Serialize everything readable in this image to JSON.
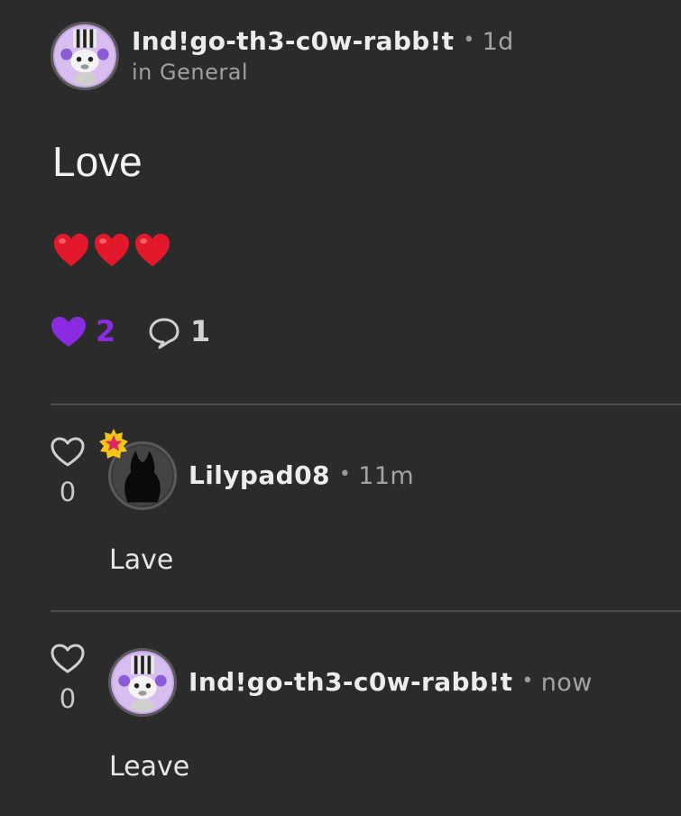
{
  "post": {
    "author": "Ind!go-th3-c0w-rabb!t",
    "separator": "•",
    "time": "1d",
    "community": "in General",
    "title": "Love",
    "body_emoji": "❤️❤️❤️",
    "likes": "2",
    "comments": "1",
    "like_color": "#8a2be2"
  },
  "comments": [
    {
      "author": "Lilypad08",
      "time": "11m",
      "body": "Lave",
      "votes": "0",
      "avatar_icon": "dark-silhouette-avatar",
      "badge_icon": "star-badge-icon"
    },
    {
      "author": "Ind!go-th3-c0w-rabb!t",
      "time": "now",
      "body": "Leave",
      "votes": "0",
      "avatar_icon": "bunny-character-avatar"
    }
  ]
}
